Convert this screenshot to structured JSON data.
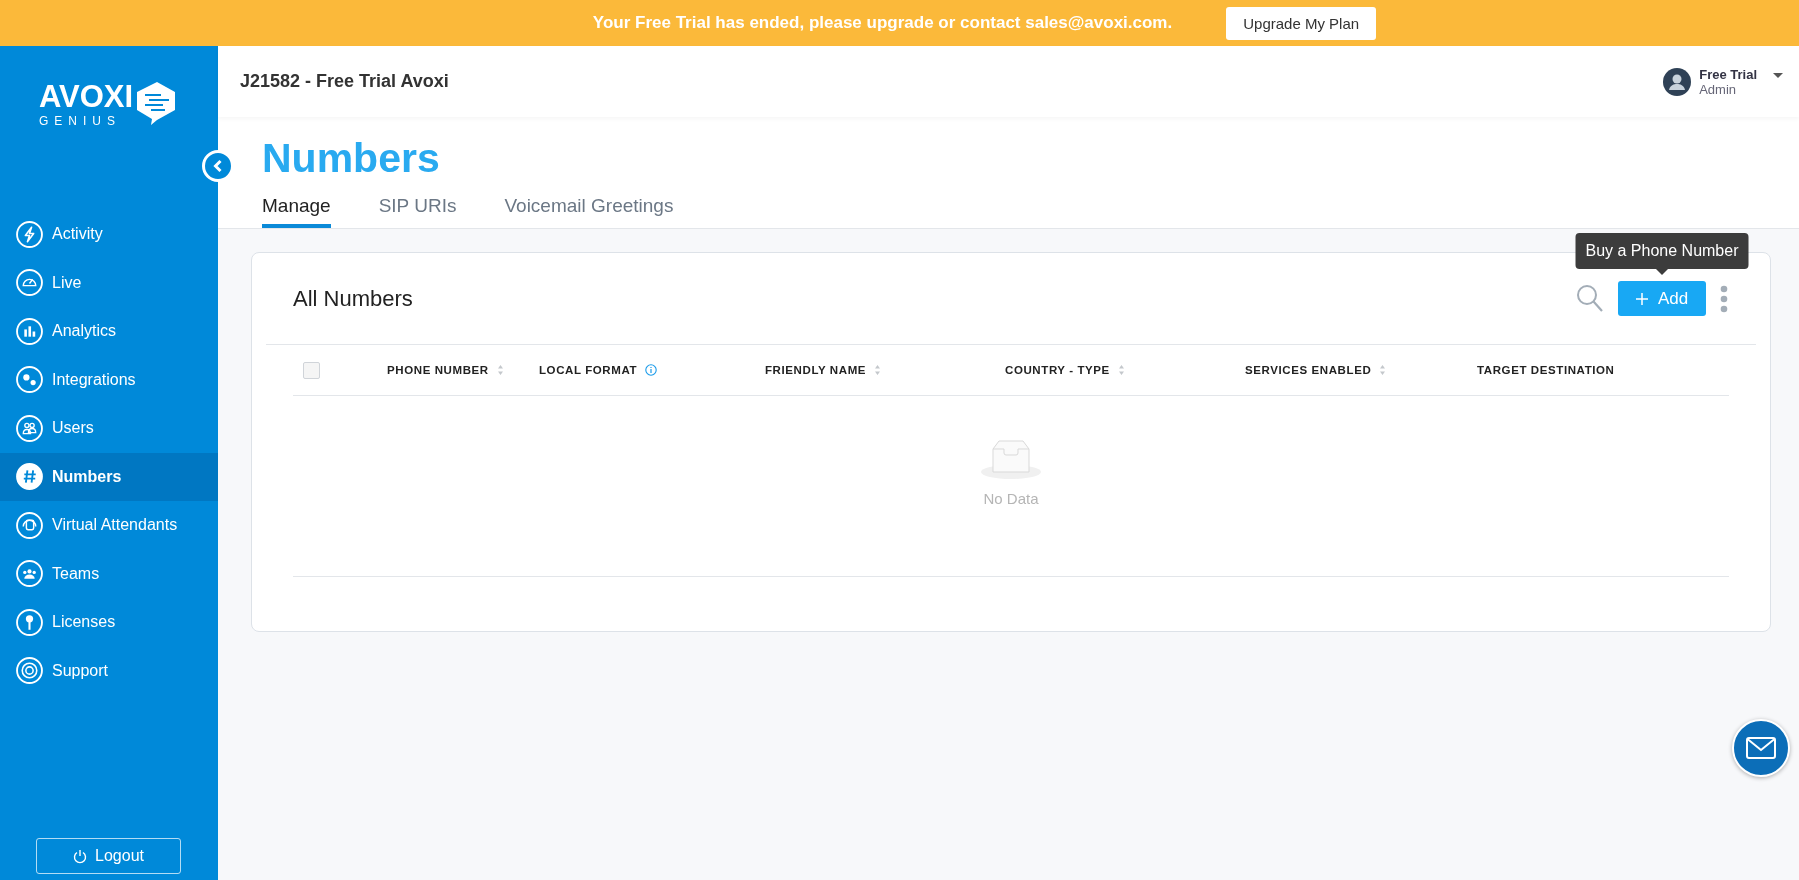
{
  "banner": {
    "message": "Your Free Trial has ended, please upgrade or contact sales@avoxi.com.",
    "button": "Upgrade My Plan"
  },
  "logo": {
    "wordmark": "AVOXI",
    "tagline": "GENIUS"
  },
  "sidebar": {
    "items": [
      {
        "label": "Activity",
        "selected": false
      },
      {
        "label": "Live",
        "selected": false
      },
      {
        "label": "Analytics",
        "selected": false
      },
      {
        "label": "Integrations",
        "selected": false
      },
      {
        "label": "Users",
        "selected": false
      },
      {
        "label": "Numbers",
        "selected": true
      },
      {
        "label": "Virtual Attendants",
        "selected": false
      },
      {
        "label": "Teams",
        "selected": false
      },
      {
        "label": "Licenses",
        "selected": false
      },
      {
        "label": "Support",
        "selected": false
      }
    ],
    "logout": "Logout"
  },
  "header": {
    "account": "J21582 - Free Trial Avoxi",
    "user": {
      "name": "Free Trial",
      "role": "Admin"
    }
  },
  "page": {
    "title": "Numbers",
    "tabs": [
      {
        "label": "Manage",
        "selected": true
      },
      {
        "label": "SIP URIs",
        "selected": false
      },
      {
        "label": "Voicemail Greetings",
        "selected": false
      }
    ]
  },
  "card": {
    "title": "All Numbers",
    "add_button": "Add",
    "tooltip": "Buy a Phone Number",
    "table": {
      "select_all": {
        "checked": false
      },
      "columns": [
        {
          "label": "PHONE NUMBER",
          "sortable": true,
          "info": false
        },
        {
          "label": "LOCAL FORMAT",
          "sortable": false,
          "info": true
        },
        {
          "label": "FRIENDLY NAME",
          "sortable": true,
          "info": false
        },
        {
          "label": "COUNTRY - TYPE",
          "sortable": true,
          "info": false
        },
        {
          "label": "SERVICES ENABLED",
          "sortable": true,
          "info": false
        },
        {
          "label": "TARGET DESTINATION",
          "sortable": false,
          "info": false
        }
      ],
      "empty_text": "No Data"
    }
  }
}
